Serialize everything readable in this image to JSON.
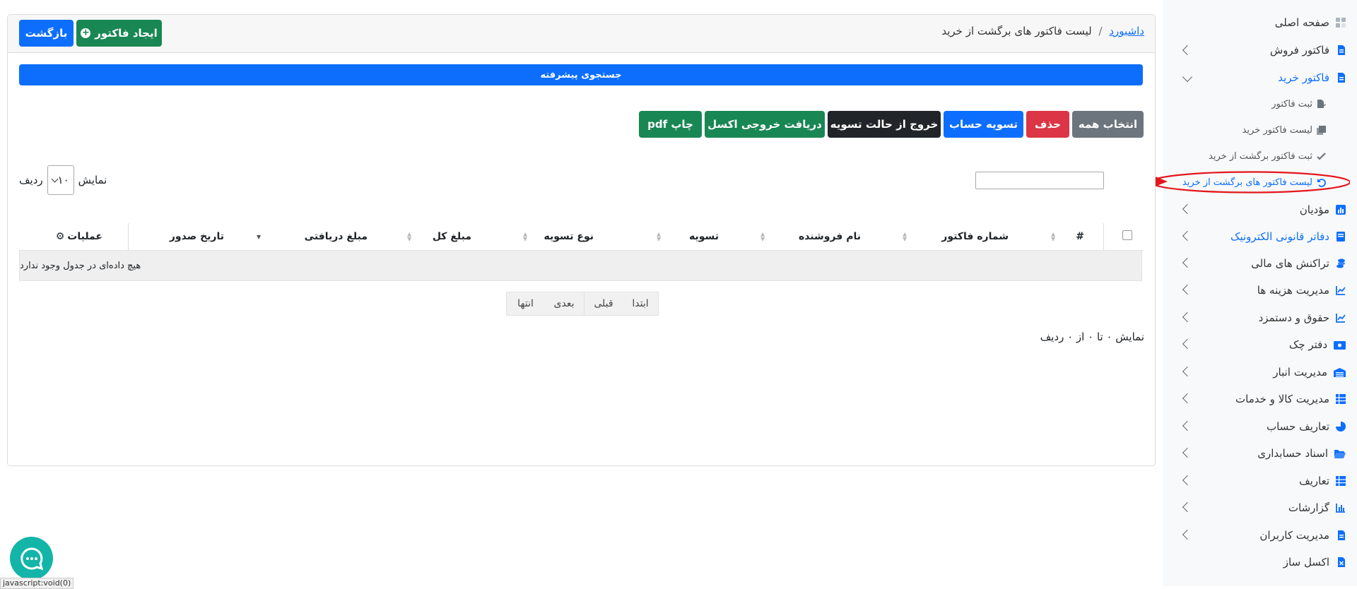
{
  "breadcrumb": {
    "home": "داشبورد",
    "separator": "/",
    "current": "لیست فاکتور های برگشت از خرید"
  },
  "header_buttons": {
    "back": "بازگشت",
    "create": "ایجاد فاکتور"
  },
  "advanced_search": "جستجوی پیشرفته",
  "actions": {
    "select_all": "انتخاب همه",
    "delete": "حذف",
    "settle": "تسویه حساب",
    "unsettle": "خروج از حالت تسویه",
    "excel": "دریافت خروجی اکسل",
    "pdf": "چاپ pdf"
  },
  "length_menu": {
    "prefix": "نمایش",
    "value": "۱۰",
    "suffix": "ردیف"
  },
  "search_input": {
    "value": ""
  },
  "table": {
    "columns": [
      "#",
      "شماره فاکتور",
      "نام فروشنده",
      "تسویه",
      "نوع تسویه",
      "مبلغ کل",
      "مبلغ دریافتی",
      "تاریخ صدور",
      "عملیات"
    ],
    "empty": "هیچ داده‌ای در جدول وجود ندارد"
  },
  "pagination": {
    "first": "ابتدا",
    "prev": "قبلی",
    "next": "بعدی",
    "last": "انتها"
  },
  "info": "نمایش ۰ تا ۰ از ۰ ردیف",
  "status_bar": "javascript:void(0)",
  "sidebar": {
    "items": [
      {
        "label": "صفحه اصلی"
      },
      {
        "label": "فاکتور فروش"
      },
      {
        "label": "فاکتور خرید"
      },
      {
        "label": "ثبت فاکتور"
      },
      {
        "label": "لیست فاکتور خرید"
      },
      {
        "label": "ثبت فاکتور برگشت از خرید"
      },
      {
        "label": "لیست فاکتور های برگشت از خرید"
      },
      {
        "label": "مؤدیان"
      },
      {
        "label": "دفاتر قانونی الکترونیک"
      },
      {
        "label": "تراکنش های مالی"
      },
      {
        "label": "مدیریت هزینه ها"
      },
      {
        "label": "حقوق و دستمزد"
      },
      {
        "label": "دفتر چک"
      },
      {
        "label": "مدیریت انبار"
      },
      {
        "label": "مدیریت کالا و خدمات"
      },
      {
        "label": "تعاریف حساب"
      },
      {
        "label": "اسناد حسابداری"
      },
      {
        "label": "تعاریف"
      },
      {
        "label": "گزارشات"
      },
      {
        "label": "مدیریت کاربران"
      },
      {
        "label": "اکسل ساز"
      }
    ]
  },
  "colors": {
    "primary": "#0d6efd",
    "success": "#198754",
    "danger": "#dc3545",
    "secondary": "#6c757d",
    "dark": "#212529",
    "annotation": "#e3161c"
  }
}
